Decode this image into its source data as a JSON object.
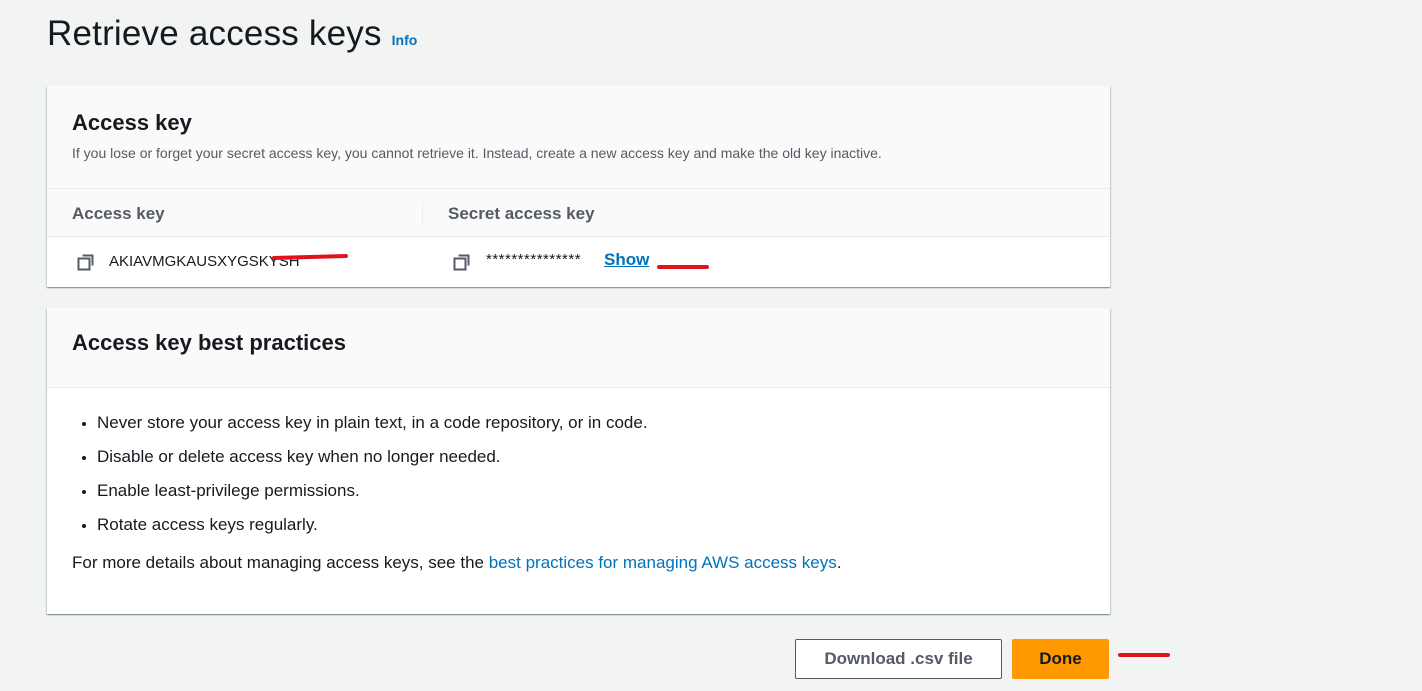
{
  "header": {
    "title": "Retrieve access keys",
    "info_label": "Info"
  },
  "access_key_panel": {
    "title": "Access key",
    "description": "If you lose or forget your secret access key, you cannot retrieve it. Instead, create a new access key and make the old key inactive.",
    "columns": {
      "access_key": "Access key",
      "secret_access_key": "Secret access key"
    },
    "access_key_value": "AKIAVMGKAUSXYGSKYSH",
    "secret_value": "***************",
    "show_label": "Show"
  },
  "best_practices_panel": {
    "title": "Access key best practices",
    "items": [
      "Never store your access key in plain text, in a code repository, or in code.",
      "Disable or delete access key when no longer needed.",
      "Enable least-privilege permissions.",
      "Rotate access keys regularly."
    ],
    "footer_prefix": "For more details about managing access keys, see the ",
    "footer_link": "best practices for managing AWS access keys",
    "footer_suffix": "."
  },
  "actions": {
    "download_label": "Download .csv file",
    "done_label": "Done"
  },
  "icons": {
    "copy": "copy-icon"
  },
  "colors": {
    "accent": "#0073bb",
    "primary_button": "#ff9900",
    "annotation": "#e0121a",
    "background": "#f2f3f3"
  }
}
